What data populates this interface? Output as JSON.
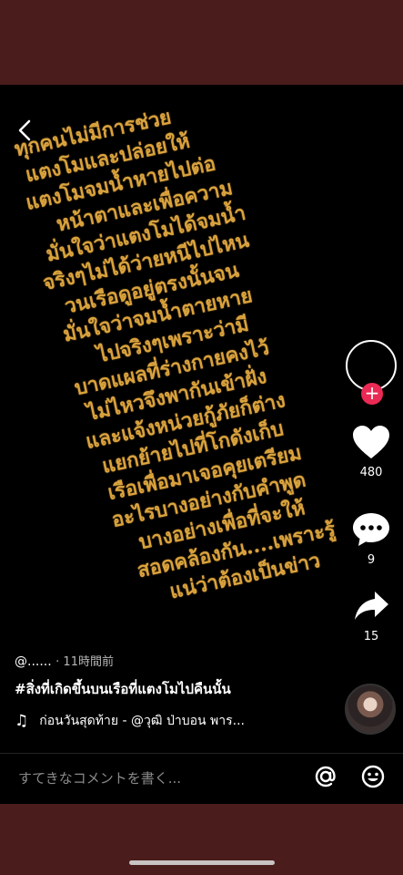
{
  "lyrics": [
    "ทุกคนไม่มีการช่วย",
    "แตงโมและปล่อยให้",
    "แตงโมจมน้ำหายไปต่อ",
    "หน้าตาและเพื่อความ",
    "มั่นใจว่าแตงโมได้จมน้ำ",
    "จริงๆไม่ได้ว่ายหนีไปไหน",
    "วนเรือดูอยู่ตรงนั้นจน",
    "มั่นใจว่าจมน้ำตายหาย",
    "ไปจริงๆเพราะว่ามี",
    "บาดแผลที่ร่างกายคงไว้",
    "ไม่ไหวจึงพากันเข้าฝั่ง",
    "และแจ้งหน่วยกู้ภัยก็ต่าง",
    "แยกย้ายไปที่โกดังเก็บ",
    "เรือเพื่อมาเจอคุยเตรียม",
    "อะไรบางอย่างกับคำพูด",
    "บางอย่างเพื่อที่จะให้",
    "สอดคล้องกัน....เพราะรู้",
    "แน่ว่าต้องเป็นข่าว"
  ],
  "rail": {
    "likes": "480",
    "comments": "9",
    "shares": "15"
  },
  "meta": {
    "author": "@......",
    "time": "· 11時間前",
    "caption": "#สิ่งที่เกิดขึ้นบนเรือที่แตงโมไปคืนนั้น",
    "music": "ก่อนวันสุดท้าย - @วุฒิ ป่าบอน พาร..."
  },
  "comment": {
    "placeholder": "すてきなコメントを書く..."
  },
  "colors": {
    "lyric": "#d9a23d",
    "follow": "#ea2a54",
    "frame": "#4a1c1c"
  }
}
